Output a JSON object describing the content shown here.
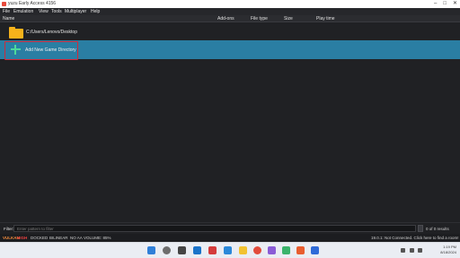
{
  "window": {
    "title": "yuzu Early Access 4156"
  },
  "menu": {
    "items": [
      "File",
      "Emulation",
      "View",
      "Tools",
      "Multiplayer",
      "Help"
    ]
  },
  "columns": {
    "name": "Name",
    "addons": "Add-ons",
    "filetype": "File type",
    "size": "Size",
    "playtime": "Play time"
  },
  "list": {
    "directory_path": "C:/Users/Lenovo/Desktop",
    "add_label": "Add New Game Directory"
  },
  "filter": {
    "label": "Filter:",
    "placeholder": "Enter pattern to filter",
    "count": "0 of 0 results"
  },
  "status": {
    "api": "VULKAN",
    "gpu_accuracy": "HIGH",
    "mode": "DOCKED",
    "filter_mode": "BILINEAR",
    "aa": "NO AA",
    "volume": "VOLUME: 85%",
    "network": "19.0.1: Not Connected. Click here to find a room!"
  },
  "taskbar": {
    "time": "1:19 PM",
    "date": "8/18/2024"
  },
  "colors": {
    "accent": "#2a7ea3",
    "folder": "#f7b21b",
    "plus": "#4dd99a",
    "highlight_border": "#d02a3a"
  }
}
